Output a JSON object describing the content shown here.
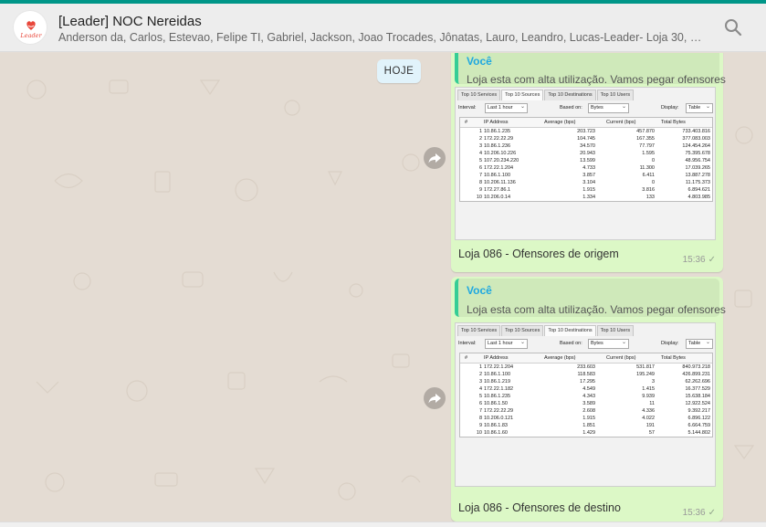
{
  "header": {
    "title": "[Leader] NOC Nereidas",
    "members": "Anderson da, Carlos, Estevao, Felipe TI, Gabriel, Jackson, Joao Trocades, Jônatas, Lauro, Leandro, Lucas-Leader- Loja 30, Marcelo Barbo…",
    "avatar_logo_text": "Leader",
    "search_icon": "search-icon"
  },
  "day_chip": "HOJE",
  "colors": {
    "accent": "#009688",
    "bubble_out": "#dcf8c6",
    "quote_author": "#1fa8e0",
    "quote_bar": "#35cd96"
  },
  "messages": [
    {
      "quote_author": "Você",
      "quote_text": "Loja esta com alta utilização. Vamos pegar ofensores",
      "caption": "Loja 086 - Ofensores de origem",
      "time": "15:36",
      "status_icon": "double-check-icon",
      "screenshot": {
        "tabs": [
          "Top 10 Services",
          "Top 10 Sources",
          "Top 10 Destinations",
          "Top 10 Users"
        ],
        "active_tab": 1,
        "interval_label": "Interval:",
        "interval_value": "Last 1 hour",
        "based_label": "Based on:",
        "based_value": "Bytes",
        "display_label": "Display:",
        "display_value": "Table",
        "columns": [
          "#",
          "IP Address",
          "Average (bps)",
          "Current (bps)",
          "Total Bytes"
        ],
        "rows": [
          [
            "1",
            "10.86.1.235",
            "203.723",
            "457.870",
            "733.403.816"
          ],
          [
            "2",
            "172.22.22.29",
            "104.745",
            "167.355",
            "377.083.003"
          ],
          [
            "3",
            "10.86.1.236",
            "34.570",
            "77.797",
            "124.454.264"
          ],
          [
            "4",
            "10.206.10.226",
            "20.943",
            "1.595",
            "75.395.678"
          ],
          [
            "5",
            "107.20.234.220",
            "13.599",
            "0",
            "48.956.754"
          ],
          [
            "6",
            "172.22.1.204",
            "4.733",
            "11.300",
            "17.039.265"
          ],
          [
            "7",
            "10.86.1.100",
            "3.857",
            "6.411",
            "13.887.278"
          ],
          [
            "8",
            "10.206.11.136",
            "3.104",
            "0",
            "11.175.373"
          ],
          [
            "9",
            "172.27.86.1",
            "1.915",
            "3.816",
            "6.894.621"
          ],
          [
            "10",
            "10.206.0.14",
            "1.334",
            "133",
            "4.803.985"
          ]
        ]
      }
    },
    {
      "quote_author": "Você",
      "quote_text": "Loja esta com alta utilização. Vamos pegar ofensores",
      "caption": "Loja 086 - Ofensores de destino",
      "time": "15:36",
      "status_icon": "double-check-icon",
      "screenshot": {
        "tabs": [
          "Top 10 Services",
          "Top 10 Sources",
          "Top 10 Destinations",
          "Top 10 Users"
        ],
        "active_tab": 2,
        "interval_label": "Interval:",
        "interval_value": "Last 1 hour",
        "based_label": "Based on:",
        "based_value": "Bytes",
        "display_label": "Display:",
        "display_value": "Table",
        "columns": [
          "#",
          "IP Address",
          "Average (bps)",
          "Current (bps)",
          "Total Bytes"
        ],
        "rows": [
          [
            "1",
            "172.22.1.204",
            "233.603",
            "531.817",
            "840.973.218"
          ],
          [
            "2",
            "10.86.1.100",
            "118.583",
            "195.249",
            "426.899.231"
          ],
          [
            "3",
            "10.86.1.219",
            "17.295",
            "3",
            "62.262.696"
          ],
          [
            "4",
            "172.22.1.182",
            "4.549",
            "1.415",
            "16.377.529"
          ],
          [
            "5",
            "10.86.1.235",
            "4.343",
            "9.939",
            "15.638.184"
          ],
          [
            "6",
            "10.86.1.50",
            "3.589",
            "11",
            "12.922.524"
          ],
          [
            "7",
            "172.22.22.29",
            "2.608",
            "4.336",
            "9.392.217"
          ],
          [
            "8",
            "10.206.0.121",
            "1.915",
            "4.022",
            "6.896.122"
          ],
          [
            "9",
            "10.86.1.83",
            "1.851",
            "191",
            "6.664.759"
          ],
          [
            "10",
            "10.86.1.60",
            "1.429",
            "57",
            "5.144.802"
          ]
        ]
      }
    }
  ]
}
